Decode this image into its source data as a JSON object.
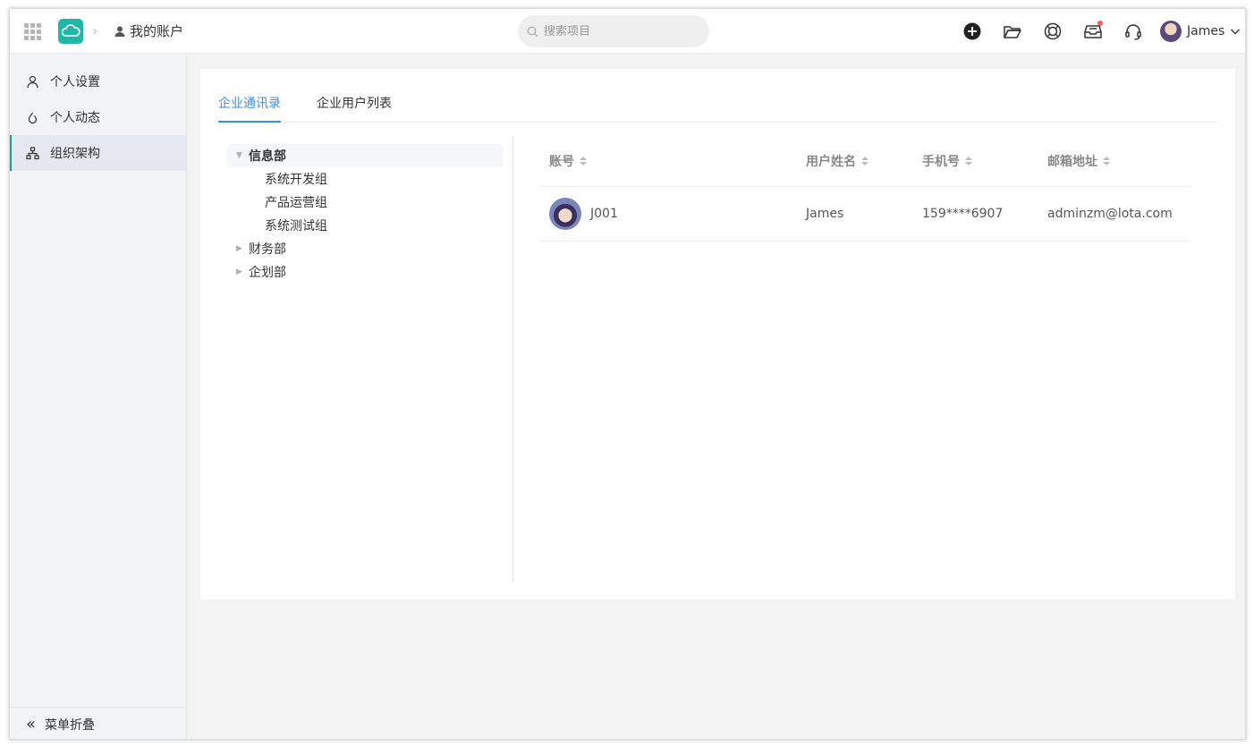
{
  "topbar": {
    "breadcrumb_label": "我的账户",
    "search_placeholder": "搜索项目",
    "user_name": "James",
    "notification_dot": true
  },
  "sidebar": {
    "items": [
      {
        "label": "个人设置",
        "icon": "user-icon"
      },
      {
        "label": "个人动态",
        "icon": "activity-icon"
      },
      {
        "label": "组织架构",
        "icon": "org-chart-icon",
        "active": true
      }
    ],
    "collapse_label": "菜单折叠"
  },
  "tabs": [
    {
      "label": "企业通讯录",
      "active": true
    },
    {
      "label": "企业用户列表",
      "active": false
    }
  ],
  "tree": [
    {
      "label": "信息部",
      "expanded": true,
      "selected": true
    },
    {
      "label": "系统开发组",
      "level": 2
    },
    {
      "label": "产品运营组",
      "level": 2
    },
    {
      "label": "系统测试组",
      "level": 2
    },
    {
      "label": "财务部",
      "expanded": false
    },
    {
      "label": "企划部",
      "expanded": false
    }
  ],
  "table": {
    "columns": [
      "账号",
      "用户姓名",
      "手机号",
      "邮箱地址"
    ],
    "rows": [
      {
        "account": "J001",
        "name": "James",
        "phone": "159****6907",
        "email": "adminzm@lota.com"
      }
    ]
  },
  "colors": {
    "accent": "#3b8ee8",
    "brand": "#1fb8a8",
    "badge": "#f25c54"
  }
}
